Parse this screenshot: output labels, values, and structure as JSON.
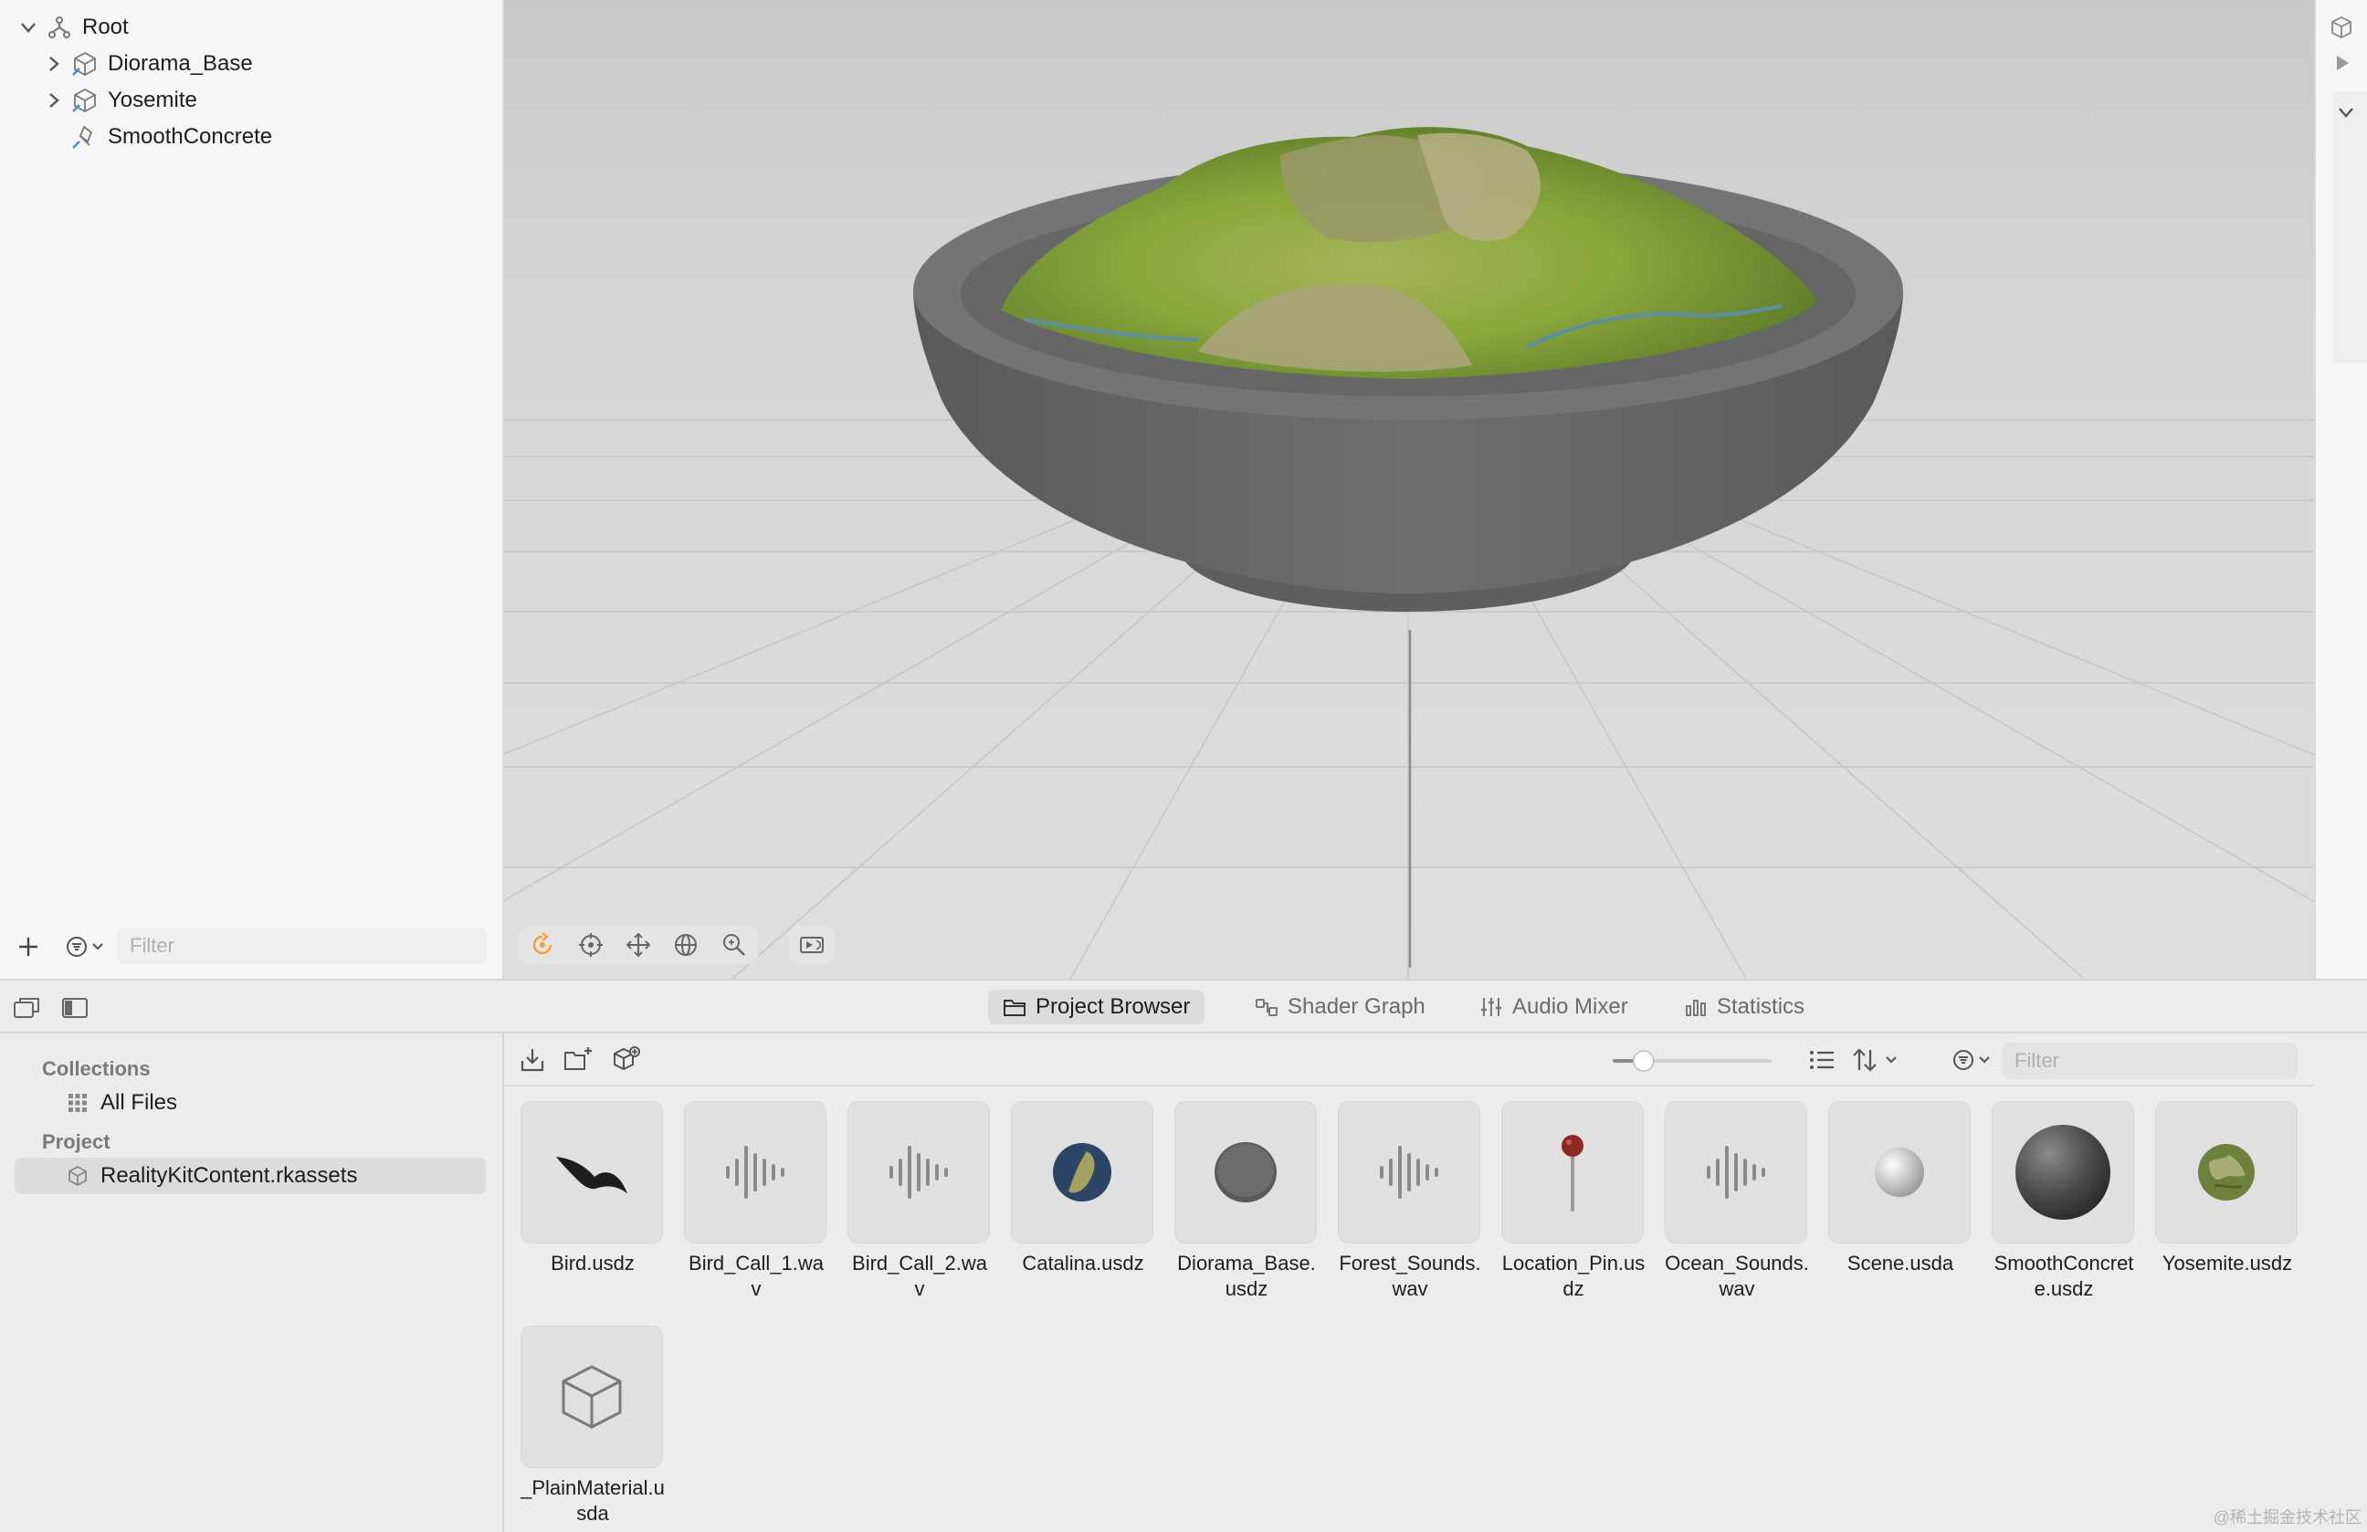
{
  "hierarchy": {
    "root_label": "Root",
    "items": [
      {
        "label": "Diorama_Base"
      },
      {
        "label": "Yosemite"
      },
      {
        "label": "SmoothConcrete"
      }
    ],
    "filter_placeholder": "Filter"
  },
  "tabs": [
    {
      "label": "Project Browser",
      "active": true
    },
    {
      "label": "Shader Graph",
      "active": false
    },
    {
      "label": "Audio Mixer",
      "active": false
    },
    {
      "label": "Statistics",
      "active": false
    }
  ],
  "collections": {
    "collections_title": "Collections",
    "all_files": "All Files",
    "project_title": "Project",
    "project_item": "RealityKitContent.rkassets"
  },
  "browser": {
    "filter_placeholder": "Filter",
    "zoom_level": 0.15,
    "assets": [
      {
        "name": "Bird.usdz",
        "icon": "bird-icon"
      },
      {
        "name": "Bird_Call_1.wav",
        "icon": "waveform-icon"
      },
      {
        "name": "Bird_Call_2.wav",
        "icon": "waveform-icon"
      },
      {
        "name": "Catalina.usdz",
        "icon": "globe-icon"
      },
      {
        "name": "Diorama_Base.usdz",
        "icon": "disc-icon"
      },
      {
        "name": "Forest_Sounds.wav",
        "icon": "waveform-icon"
      },
      {
        "name": "Location_Pin.usdz",
        "icon": "pin-icon"
      },
      {
        "name": "Ocean_Sounds.wav",
        "icon": "waveform-icon"
      },
      {
        "name": "Scene.usda",
        "icon": "sphere-small-icon"
      },
      {
        "name": "SmoothConcrete.usdz",
        "icon": "sphere-dark-icon"
      },
      {
        "name": "Yosemite.usdz",
        "icon": "terrain-icon"
      },
      {
        "name": "_PlainMaterial.usda",
        "icon": "cube-icon"
      }
    ]
  },
  "watermark": "@稀土掘金技术社区",
  "colors": {
    "accent_orange": "#f0a030",
    "selection": "#dcdcdc",
    "terrain_green": "#8aa83c"
  }
}
